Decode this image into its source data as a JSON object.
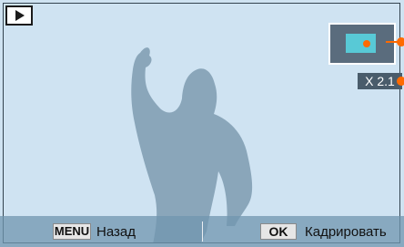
{
  "mode_icon": "play-icon",
  "zoom": {
    "level": "X 2.1"
  },
  "bottom_bar": {
    "menu_key": "MENU",
    "menu_label": "Назад",
    "ok_key": "OK",
    "ok_label": "Кадрировать"
  },
  "colors": {
    "background": "#cfe3f2",
    "silhouette": "#8aa6ba",
    "accent": "#ff6a00",
    "viewport": "#58c9d6"
  }
}
